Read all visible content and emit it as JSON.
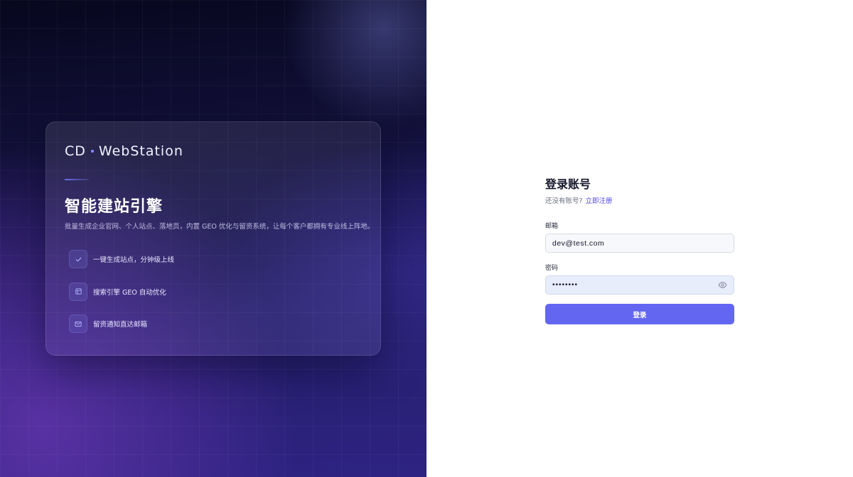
{
  "hero": {
    "brand_left": "CD",
    "brand_right": "WebStation",
    "title": "智能建站引擎",
    "description": "批量生成企业官网、个人站点、落地页，内置 GEO 优化与留资系统，让每个客户都拥有专业线上阵地。",
    "features": [
      {
        "icon": "check-icon",
        "label": "一键生成站点，分钟级上线"
      },
      {
        "icon": "layout-icon",
        "label": "搜索引擎 GEO 自动优化"
      },
      {
        "icon": "mail-icon",
        "label": "留资通知直达邮箱"
      }
    ]
  },
  "login": {
    "title": "登录账号",
    "no_account_text": "还没有账号?",
    "register_link": "立即注册",
    "email_label": "邮箱",
    "email_value": "dev@test.com",
    "password_label": "密码",
    "password_value": "••••••••",
    "submit_label": "登录"
  },
  "colors": {
    "accent": "#6366f1",
    "link": "#4f46e5",
    "hero_dark": "#0b0a24",
    "hero_purple": "#3b2a96"
  }
}
